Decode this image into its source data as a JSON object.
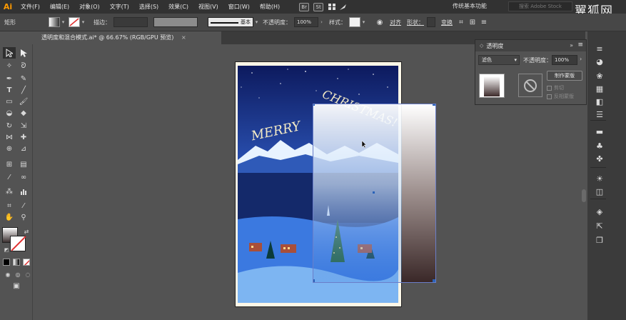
{
  "app": {
    "logo": "Ai"
  },
  "menu": [
    {
      "id": "file",
      "label": "文件(F)"
    },
    {
      "id": "edit",
      "label": "编辑(E)"
    },
    {
      "id": "object",
      "label": "对象(O)"
    },
    {
      "id": "type",
      "label": "文字(T)"
    },
    {
      "id": "select",
      "label": "选择(S)"
    },
    {
      "id": "effect",
      "label": "效果(C)"
    },
    {
      "id": "view",
      "label": "视图(V)"
    },
    {
      "id": "window",
      "label": "窗口(W)"
    },
    {
      "id": "help",
      "label": "帮助(H)"
    }
  ],
  "app_buttons": {
    "br": "Br",
    "st": "St"
  },
  "workspace": "传统基本功能",
  "search_placeholder": "搜索 Adobe Stock",
  "watermark": "翼狐网",
  "control": {
    "object_label": "矩形",
    "stroke_label": "描边：",
    "stroke_style": "基本",
    "opacity_label": "不透明度：",
    "opacity_value": "100%",
    "style_label": "样式：",
    "align_label": "对齐",
    "shape_label": "形状：",
    "transform_label": "变换"
  },
  "document": {
    "tab_title": "透明度和混合模式.ai* @ 66.67% (RGB/GPU 预览)",
    "close": "×"
  },
  "artwork": {
    "text_merry": "MERRY",
    "text_christmas": "CHRISTMAS!"
  },
  "transparency_panel": {
    "title": "透明度",
    "mode": "滤色",
    "opacity_label": "不透明度：",
    "opacity_value": "100%",
    "make_mask": "制作蒙版",
    "clip": "剪切",
    "invert_mask": "反相蒙版"
  },
  "colors": {
    "accent": "#ff9a00",
    "selection": "#6a7ec9",
    "panel": "#535353",
    "menubar": "#323232"
  }
}
